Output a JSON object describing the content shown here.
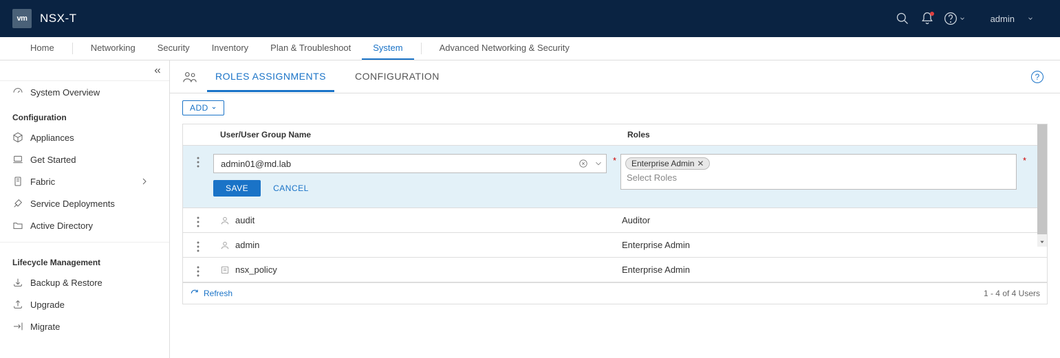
{
  "header": {
    "logo_text": "vm",
    "product": "NSX-T",
    "user": "admin"
  },
  "menubar": {
    "items": [
      "Home",
      "Networking",
      "Security",
      "Inventory",
      "Plan & Troubleshoot",
      "System",
      "Advanced Networking & Security"
    ],
    "active_index": 5
  },
  "sidebar": {
    "top_item": "System Overview",
    "sections": [
      {
        "heading": "Configuration",
        "items": [
          "Appliances",
          "Get Started",
          "Fabric",
          "Service Deployments",
          "Active Directory"
        ]
      },
      {
        "heading": "Lifecycle Management",
        "items": [
          "Backup & Restore",
          "Upgrade",
          "Migrate"
        ]
      }
    ]
  },
  "subtabs": {
    "items": [
      "ROLES ASSIGNMENTS",
      "CONFIGURATION"
    ],
    "active_index": 0
  },
  "toolbar": {
    "add_label": "ADD"
  },
  "grid": {
    "columns": {
      "user": "User/User Group Name",
      "roles": "Roles"
    },
    "edit_row": {
      "user_value": "admin01@md.lab",
      "role_chip": "Enterprise Admin",
      "roles_placeholder": "Select Roles",
      "save_label": "SAVE",
      "cancel_label": "CANCEL"
    },
    "rows": [
      {
        "type": "user",
        "name": "audit",
        "roles": "Auditor"
      },
      {
        "type": "user",
        "name": "admin",
        "roles": "Enterprise Admin"
      },
      {
        "type": "policy",
        "name": "nsx_policy",
        "roles": "Enterprise Admin"
      }
    ],
    "footer": {
      "refresh_label": "Refresh",
      "count_text": "1 - 4 of 4 Users"
    }
  }
}
